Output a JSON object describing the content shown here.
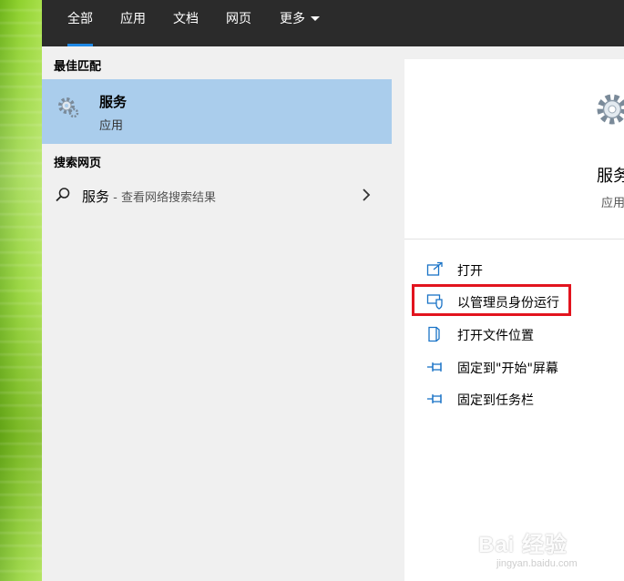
{
  "tabs": [
    {
      "label": "全部"
    },
    {
      "label": "应用"
    },
    {
      "label": "文档"
    },
    {
      "label": "网页"
    },
    {
      "label": "更多"
    }
  ],
  "best_match": {
    "heading": "最佳匹配",
    "title": "服务",
    "subtitle": "应用"
  },
  "web_search": {
    "heading": "搜索网页",
    "term": "服务",
    "description": " - 查看网络搜索结果"
  },
  "detail": {
    "app_name": "服务",
    "app_type": "应用",
    "actions": [
      {
        "label": "打开",
        "icon": "open-icon"
      },
      {
        "label": "以管理员身份运行",
        "icon": "shield-run-icon"
      },
      {
        "label": "打开文件位置",
        "icon": "file-location-icon"
      },
      {
        "label": "固定到\"开始\"屏幕",
        "icon": "pin-icon"
      },
      {
        "label": "固定到任务栏",
        "icon": "pin-icon"
      }
    ]
  },
  "watermark": {
    "brand": "Bai 经验",
    "url": "jingyan.baidu.com"
  },
  "colors": {
    "accent": "#1e88e5",
    "selected": "#aacdec",
    "highlight": "#e2141e",
    "icon_blue": "#1a73c7"
  }
}
